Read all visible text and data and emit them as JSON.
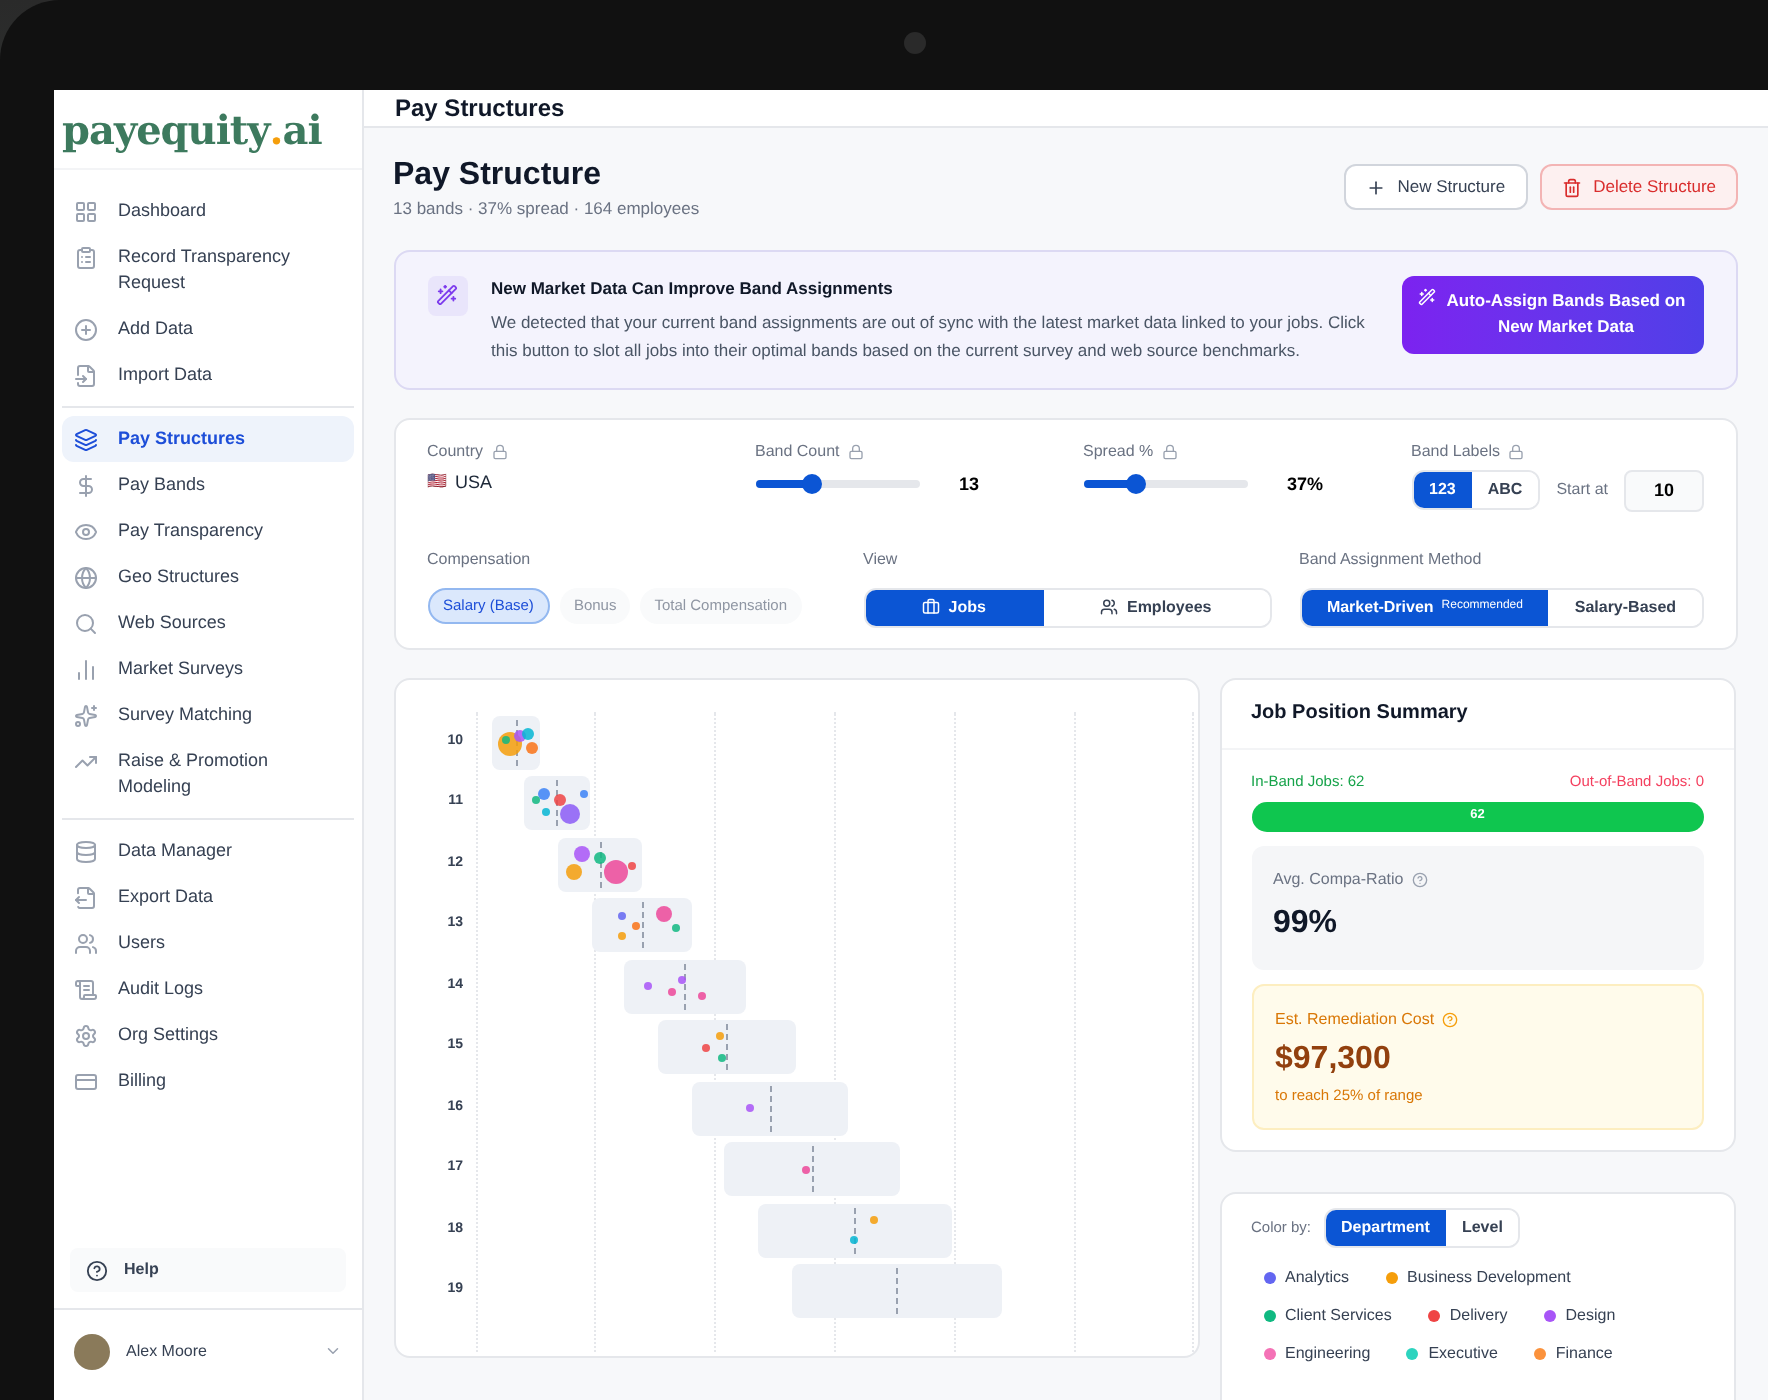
{
  "logo": {
    "name": "payequity",
    "dot": ".",
    "suffix": "ai"
  },
  "sidebar": {
    "sections": [
      {
        "items": [
          {
            "label": "Dashboard",
            "selected": false
          },
          {
            "label": "Record Transparency Request",
            "selected": false
          },
          {
            "label": "Add Data",
            "selected": false
          },
          {
            "label": "Import Data",
            "selected": false
          }
        ]
      },
      {
        "items": [
          {
            "label": "Pay Structures",
            "selected": true
          },
          {
            "label": "Pay Bands",
            "selected": false
          },
          {
            "label": "Pay Transparency",
            "selected": false
          },
          {
            "label": "Geo Structures",
            "selected": false
          },
          {
            "label": "Web Sources",
            "selected": false
          },
          {
            "label": "Market Surveys",
            "selected": false
          },
          {
            "label": "Survey Matching",
            "selected": false
          },
          {
            "label": "Raise & Promotion Modeling",
            "selected": false
          }
        ]
      },
      {
        "items": [
          {
            "label": "Data Manager",
            "selected": false
          },
          {
            "label": "Export Data",
            "selected": false
          },
          {
            "label": "Users",
            "selected": false
          },
          {
            "label": "Audit Logs",
            "selected": false
          },
          {
            "label": "Org Settings",
            "selected": false
          },
          {
            "label": "Billing",
            "selected": false
          }
        ]
      }
    ],
    "help": "Help",
    "user": "Alex Moore"
  },
  "header": {
    "title": "Pay Structures"
  },
  "page": {
    "title": "Pay Structure",
    "subtitle": "13 bands · 37% spread · 164 employees",
    "buttons": [
      {
        "label": "New Structure",
        "kind": "default"
      },
      {
        "label": "Delete Structure",
        "kind": "danger"
      }
    ]
  },
  "banner": {
    "title": "New Market Data Can Improve Band Assignments",
    "text": "We detected that your current band assignments are out of sync with the latest market data linked to your jobs. Click this button to slot all jobs into their optimal bands based on the current survey and web source benchmarks.",
    "button": "Auto-Assign Bands Based on New Market Data"
  },
  "settings": {
    "country": {
      "label": "Country",
      "flag": "🇺🇸",
      "value": "USA"
    },
    "band_count": {
      "label": "Band Count",
      "level": 0.35,
      "reading": "13"
    },
    "spread": {
      "label": "Spread %",
      "level": 0.32,
      "reading": "37%"
    },
    "band_labels": {
      "label": "Band Labels",
      "options": [
        {
          "label": "123",
          "selected": true
        },
        {
          "label": "ABC",
          "selected": false
        }
      ],
      "start_label": "Start at",
      "start_value": "10"
    },
    "compensation": {
      "label": "Compensation",
      "options": [
        {
          "label": "Salary (Base)",
          "selected": true,
          "disabled": false
        },
        {
          "label": "Bonus",
          "selected": false,
          "disabled": true
        },
        {
          "label": "Total Compensation",
          "selected": false,
          "disabled": true
        }
      ]
    },
    "view": {
      "label": "View",
      "options": [
        {
          "label": "Jobs",
          "selected": true
        },
        {
          "label": "Employees",
          "selected": false
        }
      ]
    },
    "method": {
      "label": "Band Assignment Method",
      "options": [
        {
          "label": "Market-Driven",
          "badge": "Recommended",
          "selected": true
        },
        {
          "label": "Salary-Based",
          "selected": false
        }
      ]
    }
  },
  "bands": [
    {
      "label": "10"
    },
    {
      "label": "11"
    },
    {
      "label": "12"
    },
    {
      "label": "13"
    },
    {
      "label": "14"
    },
    {
      "label": "15"
    },
    {
      "label": "16"
    },
    {
      "label": "17"
    },
    {
      "label": "18"
    },
    {
      "label": "19"
    }
  ],
  "summary": {
    "title": "Job Position Summary",
    "in_band": "In-Band Jobs: 62",
    "out_band": "Out-of-Band Jobs: 0",
    "bar": {
      "level": 1,
      "reading": "62"
    },
    "compa": {
      "label": "Avg. Compa-Ratio",
      "value": "99%"
    },
    "remediation": {
      "label": "Est. Remediation Cost",
      "value": "$97,300",
      "note": "to reach 25% of range"
    }
  },
  "legend": {
    "label": "Color by:",
    "options": [
      {
        "label": "Department",
        "selected": true
      },
      {
        "label": "Level",
        "selected": false
      }
    ],
    "items": [
      {
        "label": "Analytics",
        "color": "#6366f1"
      },
      {
        "label": "Business Development",
        "color": "#f59e0b"
      },
      {
        "label": "Client Services",
        "color": "#10b981"
      },
      {
        "label": "Delivery",
        "color": "#ef4444"
      },
      {
        "label": "Design",
        "color": "#a855f7"
      },
      {
        "label": "Engineering",
        "color": "#f472b6"
      },
      {
        "label": "Executive",
        "color": "#2dd4bf"
      },
      {
        "label": "Finance",
        "color": "#fb923c"
      }
    ]
  }
}
